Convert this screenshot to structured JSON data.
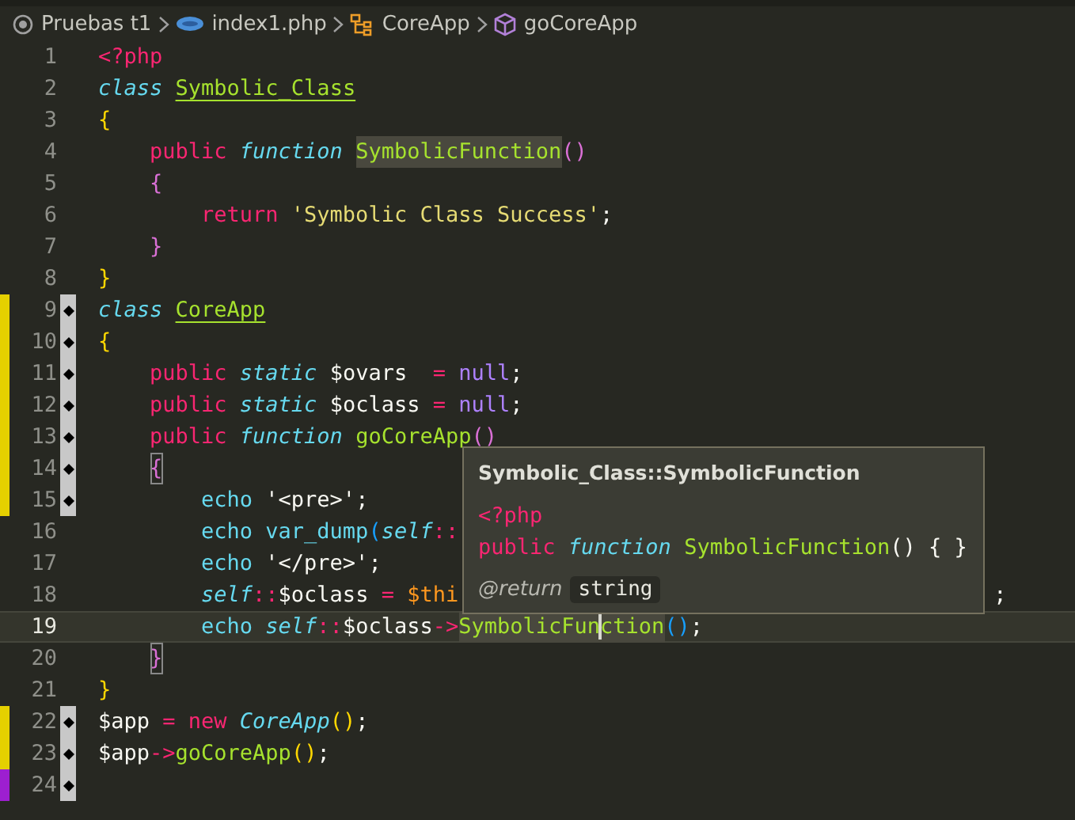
{
  "breadcrumb": [
    {
      "label": "Pruebas t1",
      "kind": "folder"
    },
    {
      "label": "index1.php",
      "kind": "php"
    },
    {
      "label": "CoreApp",
      "kind": "class"
    },
    {
      "label": "goCoreApp",
      "kind": "method"
    }
  ],
  "lines": [
    {
      "number": "1",
      "bookmark": false,
      "current": false,
      "tokens": [
        {
          "text": "<?php",
          "kind": "tag"
        }
      ]
    },
    {
      "number": "2",
      "bookmark": false,
      "current": false,
      "tokens": [
        {
          "text": "class ",
          "kind": "storage"
        },
        {
          "text": "Symbolic_Class",
          "kind": "class-name"
        }
      ]
    },
    {
      "number": "3",
      "bookmark": false,
      "current": false,
      "tokens": [
        {
          "text": "{",
          "kind": "bracket-1"
        }
      ],
      "children": [
        {
          "number": "4",
          "bookmark": false,
          "current": false,
          "tokens": [
            {
              "text": "public ",
              "kind": "keyword"
            },
            {
              "text": "function ",
              "kind": "storage"
            },
            {
              "text": "SymbolicFunction",
              "kind": "function",
              "highlight": true
            },
            {
              "text": "()",
              "kind": "bracket-2"
            }
          ]
        },
        {
          "number": "5",
          "bookmark": false,
          "current": false,
          "tokens": [
            {
              "text": "{",
              "kind": "bracket-2"
            }
          ],
          "children": [
            {
              "number": "6",
              "bookmark": false,
              "current": false,
              "tokens": [
                {
                  "text": "return ",
                  "kind": "keyword"
                },
                {
                  "text": "'Symbolic Class Success'",
                  "kind": "string"
                },
                {
                  "text": ";",
                  "kind": "plain"
                }
              ]
            }
          ]
        },
        {
          "number": "7",
          "bookmark": false,
          "current": false,
          "tokens": [
            {
              "text": "}",
              "kind": "bracket-2"
            }
          ]
        }
      ]
    },
    {
      "number": "8",
      "bookmark": false,
      "current": false,
      "tokens": [
        {
          "text": "}",
          "kind": "bracket-1"
        }
      ]
    },
    {
      "number": "9",
      "color": "#e5d000",
      "bookmark": true,
      "current": false,
      "tokens": [
        {
          "text": "class ",
          "kind": "storage"
        },
        {
          "text": "CoreApp",
          "kind": "class-name"
        }
      ]
    },
    {
      "number": "10",
      "color": "#e5d000",
      "bookmark": true,
      "current": false,
      "tokens": [
        {
          "text": "{",
          "kind": "bracket-1"
        }
      ],
      "children": [
        {
          "number": "11",
          "color": "#e5d000",
          "bookmark": true,
          "current": false,
          "tokens": [
            {
              "text": "public ",
              "kind": "keyword"
            },
            {
              "text": "static ",
              "kind": "storage"
            },
            {
              "text": "$ovars  ",
              "kind": "plain"
            },
            {
              "text": "= ",
              "kind": "operator"
            },
            {
              "text": "null",
              "kind": "constant"
            },
            {
              "text": ";",
              "kind": "plain"
            }
          ]
        },
        {
          "number": "12",
          "color": "#e5d000",
          "bookmark": true,
          "current": false,
          "tokens": [
            {
              "text": "public ",
              "kind": "keyword"
            },
            {
              "text": "static ",
              "kind": "storage"
            },
            {
              "text": "$oclass ",
              "kind": "plain"
            },
            {
              "text": "= ",
              "kind": "operator"
            },
            {
              "text": "null",
              "kind": "constant"
            },
            {
              "text": ";",
              "kind": "plain"
            }
          ]
        },
        {
          "number": "13",
          "color": "#e5d000",
          "bookmark": true,
          "current": false,
          "tokens": [
            {
              "text": "public ",
              "kind": "keyword"
            },
            {
              "text": "function ",
              "kind": "storage"
            },
            {
              "text": "goCoreApp",
              "kind": "function"
            },
            {
              "text": "()",
              "kind": "bracket-2"
            }
          ]
        },
        {
          "number": "14",
          "color": "#e5d000",
          "bookmark": true,
          "current": false,
          "tokens": [
            {
              "text": "{",
              "kind": "bracket-2",
              "match": true
            }
          ],
          "children": [
            {
              "number": "15",
              "color": "#e5d000",
              "bookmark": true,
              "current": false,
              "tokens": [
                {
                  "text": "echo ",
                  "kind": "support"
                },
                {
                  "text": "'<pre>'",
                  "kind": "plain"
                },
                {
                  "text": ";",
                  "kind": "plain"
                }
              ]
            },
            {
              "number": "16",
              "bookmark": false,
              "current": false,
              "tokens": [
                {
                  "text": "echo ",
                  "kind": "support"
                },
                {
                  "text": "var_dump",
                  "kind": "support"
                },
                {
                  "text": "(",
                  "kind": "bracket-3"
                },
                {
                  "text": "self",
                  "kind": "storage"
                },
                {
                  "text": "::",
                  "kind": "operator"
                }
              ]
            },
            {
              "number": "17",
              "bookmark": false,
              "current": false,
              "tokens": [
                {
                  "text": "echo ",
                  "kind": "support"
                },
                {
                  "text": "'</pre>'",
                  "kind": "plain"
                },
                {
                  "text": ";",
                  "kind": "plain"
                }
              ]
            },
            {
              "number": "18",
              "bookmark": false,
              "current": false,
              "tokens": [
                {
                  "text": "self",
                  "kind": "storage"
                },
                {
                  "text": "::",
                  "kind": "operator"
                },
                {
                  "text": "$oclass ",
                  "kind": "plain"
                },
                {
                  "text": "= ",
                  "kind": "operator"
                },
                {
                  "text": "$thi",
                  "kind": "this"
                }
              ],
              "tail": {
                "text": ";"
              }
            },
            {
              "number": "19",
              "bookmark": false,
              "current": true,
              "tokens": [
                {
                  "text": "echo ",
                  "kind": "support"
                },
                {
                  "text": "self",
                  "kind": "storage"
                },
                {
                  "text": "::",
                  "kind": "operator"
                },
                {
                  "text": "$oclass",
                  "kind": "plain"
                },
                {
                  "text": "->",
                  "kind": "operator"
                },
                {
                  "text": "SymbolicFun",
                  "kind": "function",
                  "highlight": true,
                  "caret": true
                },
                {
                  "text": "ction",
                  "kind": "function",
                  "highlight": true
                },
                {
                  "text": "()",
                  "kind": "bracket-3"
                },
                {
                  "text": ";",
                  "kind": "plain"
                }
              ]
            }
          ]
        },
        {
          "number": "20",
          "bookmark": false,
          "current": false,
          "tokens": [
            {
              "text": "}",
              "kind": "bracket-2",
              "match": true
            }
          ]
        }
      ]
    },
    {
      "number": "21",
      "bookmark": false,
      "current": false,
      "tokens": [
        {
          "text": "}",
          "kind": "bracket-1"
        }
      ]
    },
    {
      "number": "22",
      "color": "#e5d000",
      "bookmark": true,
      "current": false,
      "tokens": [
        {
          "text": "$app ",
          "kind": "plain"
        },
        {
          "text": "= ",
          "kind": "operator"
        },
        {
          "text": "new ",
          "kind": "keyword"
        },
        {
          "text": "CoreApp",
          "kind": "class-ref"
        },
        {
          "text": "()",
          "kind": "bracket-1"
        },
        {
          "text": ";",
          "kind": "plain"
        }
      ]
    },
    {
      "number": "23",
      "color": "#e5d000",
      "bookmark": true,
      "current": false,
      "tokens": [
        {
          "text": "$app",
          "kind": "plain"
        },
        {
          "text": "->",
          "kind": "operator"
        },
        {
          "text": "goCoreApp",
          "kind": "function"
        },
        {
          "text": "()",
          "kind": "bracket-1"
        },
        {
          "text": ";",
          "kind": "plain"
        }
      ]
    },
    {
      "number": "24",
      "color": "#9d1fd0",
      "bookmark": true,
      "current": false
    }
  ],
  "hover": {
    "title": "Symbolic_Class::SymbolicFunction",
    "code": [
      [
        {
          "text": "<?php",
          "kind": "tag"
        }
      ],
      [
        {
          "text": "public ",
          "kind": "keyword"
        },
        {
          "text": "function ",
          "kind": "storage"
        },
        {
          "text": "SymbolicFunction",
          "kind": "function"
        },
        {
          "text": "() { }",
          "kind": "plain"
        }
      ]
    ],
    "return_label": "@return",
    "return_type": "string"
  }
}
